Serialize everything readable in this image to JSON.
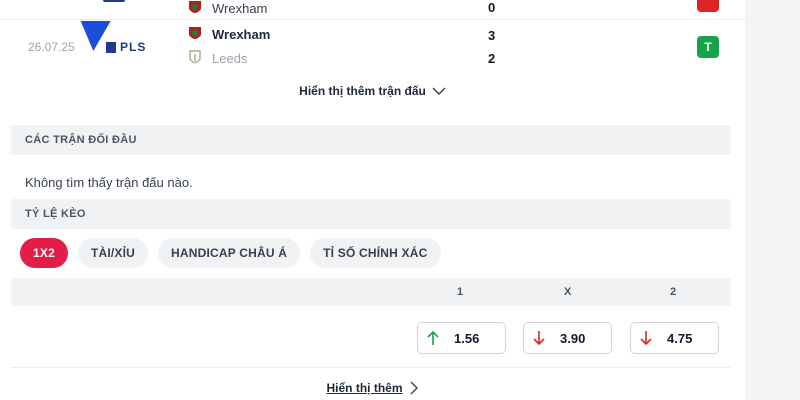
{
  "matches": [
    {
      "date": "",
      "competition": "",
      "home": {
        "name": "Wrexham",
        "score": "0"
      },
      "result_badge": {
        "text": "",
        "color": "#dc2626"
      }
    },
    {
      "date": "26.07.25",
      "competition": "PLS",
      "home": {
        "name": "Wrexham",
        "score": "3"
      },
      "away": {
        "name": "Leeds",
        "score": "2"
      },
      "result_badge": {
        "text": "T",
        "color": "#16a34a"
      }
    }
  ],
  "show_more_matches": "Hiển thị thêm trận đấu",
  "head_to_head": {
    "title": "CÁC TRẬN ĐỐI ĐẦU",
    "empty_text": "Không tìm thấy trận đấu nào."
  },
  "odds": {
    "title": "TỶ LỆ KÈO",
    "tabs": [
      {
        "label": "1X2",
        "active": true
      },
      {
        "label": "TÀI/XỈU",
        "active": false
      },
      {
        "label": "HANDICAP CHÂU Á",
        "active": false
      },
      {
        "label": "TỈ SỐ CHÍNH XÁC",
        "active": false
      }
    ],
    "columns": [
      "1",
      "X",
      "2"
    ],
    "values": [
      {
        "value": "1.56",
        "trend": "up",
        "icon": "arrow-up-icon",
        "color": "#16a34a"
      },
      {
        "value": "3.90",
        "trend": "down",
        "icon": "arrow-down-icon",
        "color": "#dc2626"
      },
      {
        "value": "4.75",
        "trend": "down",
        "icon": "arrow-down-icon",
        "color": "#dc2626"
      }
    ]
  },
  "show_more": "Hiển thị thêm",
  "colors": {
    "accent": "#e11d48",
    "up": "#16a34a",
    "down": "#dc2626"
  }
}
